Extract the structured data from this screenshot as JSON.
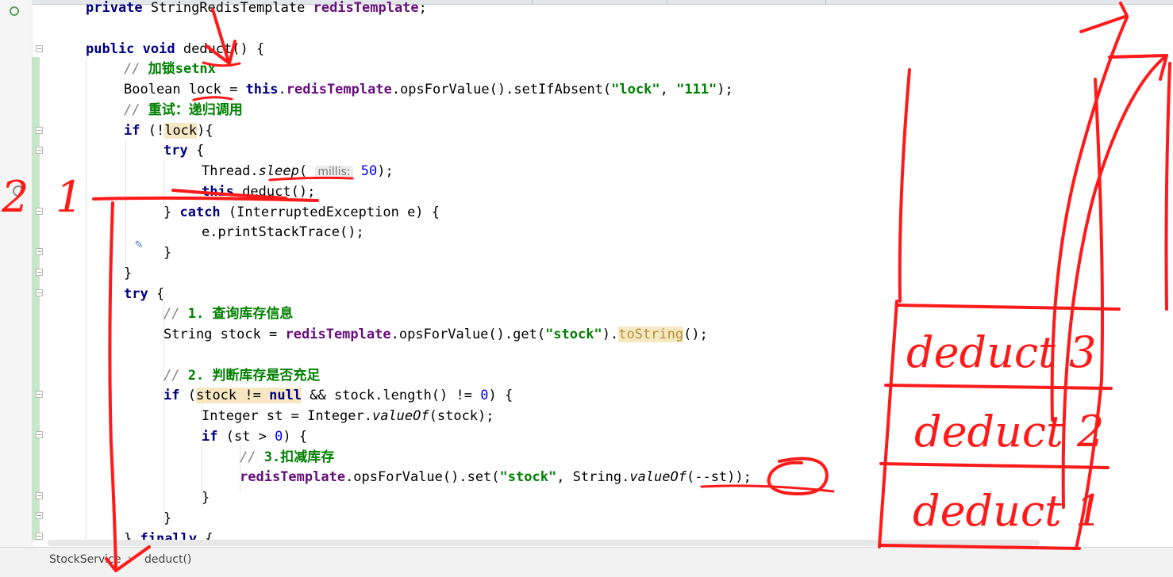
{
  "editor": {
    "code_lines": [
      {
        "tokens": [
          {
            "t": "private ",
            "c": "kw"
          },
          {
            "t": "StringRedisTemplate "
          },
          {
            "t": "redisTemplate",
            "c": "fld"
          },
          {
            "t": ";"
          }
        ]
      },
      {
        "tokens": []
      },
      {
        "tokens": [
          {
            "t": "public void ",
            "c": "kw"
          },
          {
            "t": "deduct() {"
          }
        ]
      },
      {
        "tokens": [
          {
            "t": "// ",
            "c": "cmt"
          },
          {
            "t": "加锁setnx",
            "c": "cmt-cn"
          }
        ]
      },
      {
        "tokens": [
          {
            "t": "Boolean "
          },
          {
            "t": "lock"
          },
          {
            "t": " = "
          },
          {
            "t": "this",
            "c": "kw"
          },
          {
            "t": "."
          },
          {
            "t": "redisTemplate",
            "c": "fld"
          },
          {
            "t": ".opsForValue().setIfAbsent("
          },
          {
            "t": "\"lock\"",
            "c": "str"
          },
          {
            "t": ", "
          },
          {
            "t": "\"111\"",
            "c": "str"
          },
          {
            "t": ");"
          }
        ]
      },
      {
        "tokens": [
          {
            "t": "// ",
            "c": "cmt"
          },
          {
            "t": "重试：递归调用",
            "c": "cmt-cn"
          }
        ]
      },
      {
        "tokens": [
          {
            "t": "if ",
            "c": "kw"
          },
          {
            "t": "(!"
          },
          {
            "t": "lock",
            "c": "hl"
          },
          {
            "t": "){"
          }
        ]
      },
      {
        "tokens": [
          {
            "t": "try ",
            "c": "kw"
          },
          {
            "t": "{"
          }
        ]
      },
      {
        "tokens": [
          {
            "t": "Thread."
          },
          {
            "t": "sleep",
            "c": "it"
          },
          {
            "t": "( "
          },
          {
            "t": "millis:",
            "c": "hint"
          },
          {
            "t": " "
          },
          {
            "t": "50",
            "c": "num"
          },
          {
            "t": ");"
          }
        ]
      },
      {
        "tokens": [
          {
            "t": "this",
            "c": "kw"
          },
          {
            "t": ".deduct();"
          }
        ]
      },
      {
        "tokens": [
          {
            "t": "} "
          },
          {
            "t": "catch ",
            "c": "kw"
          },
          {
            "t": "(InterruptedException e) {"
          }
        ]
      },
      {
        "tokens": [
          {
            "t": "e.printStackTrace();"
          }
        ]
      },
      {
        "tokens": [
          {
            "t": "}"
          }
        ]
      },
      {
        "tokens": [
          {
            "t": "}"
          }
        ]
      },
      {
        "tokens": [
          {
            "t": "try ",
            "c": "kw"
          },
          {
            "t": "{"
          }
        ]
      },
      {
        "tokens": [
          {
            "t": "// ",
            "c": "cmt"
          },
          {
            "t": "1. 查询库存信息",
            "c": "cmt-cn"
          }
        ]
      },
      {
        "tokens": [
          {
            "t": "String stock = "
          },
          {
            "t": "redisTemplate",
            "c": "fld"
          },
          {
            "t": ".opsForValue().get("
          },
          {
            "t": "\"stock\"",
            "c": "str"
          },
          {
            "t": ")."
          },
          {
            "t": "toString",
            "c": "dim hl"
          },
          {
            "t": "();"
          }
        ]
      },
      {
        "tokens": []
      },
      {
        "tokens": [
          {
            "t": "// ",
            "c": "cmt"
          },
          {
            "t": "2. 判断库存是否充足",
            "c": "cmt-cn"
          }
        ]
      },
      {
        "tokens": [
          {
            "t": "if ",
            "c": "kw"
          },
          {
            "t": "("
          },
          {
            "t": "stock != ",
            "c": "hl"
          },
          {
            "t": "null",
            "c": "kw hl"
          },
          {
            "t": " && stock.length() != "
          },
          {
            "t": "0",
            "c": "num"
          },
          {
            "t": ") {"
          }
        ]
      },
      {
        "tokens": [
          {
            "t": "Integer "
          },
          {
            "t": "st"
          },
          {
            "t": " = Integer."
          },
          {
            "t": "valueOf",
            "c": "it"
          },
          {
            "t": "(stock);"
          }
        ]
      },
      {
        "tokens": [
          {
            "t": "if ",
            "c": "kw"
          },
          {
            "t": "("
          },
          {
            "t": "st"
          },
          {
            "t": " > "
          },
          {
            "t": "0",
            "c": "num"
          },
          {
            "t": ") {"
          }
        ]
      },
      {
        "tokens": [
          {
            "t": "// ",
            "c": "cmt"
          },
          {
            "t": "3.扣减库存",
            "c": "cmt-cn"
          }
        ]
      },
      {
        "tokens": [
          {
            "t": "redisTemplate",
            "c": "fld"
          },
          {
            "t": ".opsForValue().set("
          },
          {
            "t": "\"stock\"",
            "c": "str"
          },
          {
            "t": ", String."
          },
          {
            "t": "valueOf",
            "c": "it"
          },
          {
            "t": "(--"
          },
          {
            "t": "st"
          },
          {
            "t": "));"
          }
        ]
      },
      {
        "tokens": [
          {
            "t": "}"
          }
        ]
      },
      {
        "tokens": [
          {
            "t": "}"
          }
        ]
      },
      {
        "tokens": [
          {
            "t": "} "
          },
          {
            "t": "finally ",
            "c": "kw"
          },
          {
            "t": "{"
          }
        ]
      }
    ]
  },
  "breadcrumb": {
    "class_name": "StockService",
    "method_name": "deduct()"
  },
  "annotations": {
    "stack_labels": [
      "deduct 3",
      "deduct 2",
      "deduct 1"
    ],
    "margin_numbers": [
      "2",
      "1"
    ],
    "ink_color": "#ff1a1a"
  }
}
